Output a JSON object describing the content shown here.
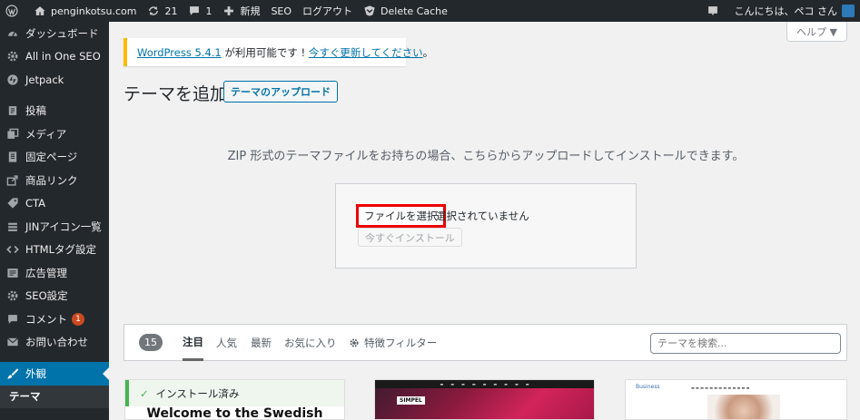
{
  "adminbar": {
    "site_name": "penginkotsu.com",
    "updates_count": "21",
    "comments_count": "1",
    "new_label": "新規",
    "seo_label": "SEO",
    "logout_label": "ログアウト",
    "delete_cache_label": "Delete Cache",
    "greeting": "こんにちは、ペコ さん"
  },
  "sidebar": {
    "items": [
      {
        "label": "ダッシュボード",
        "icon": "dashboard-icon"
      },
      {
        "label": "All in One SEO",
        "icon": "gear-icon"
      },
      {
        "label": "Jetpack",
        "icon": "jetpack-icon"
      },
      {
        "label": "投稿",
        "icon": "pin-icon"
      },
      {
        "label": "メディア",
        "icon": "media-icon"
      },
      {
        "label": "固定ページ",
        "icon": "page-icon"
      },
      {
        "label": "商品リンク",
        "icon": "link-icon"
      },
      {
        "label": "CTA",
        "icon": "tag-icon"
      },
      {
        "label": "JINアイコン一覧",
        "icon": "list-icon"
      },
      {
        "label": "HTMLタグ設定",
        "icon": "code-icon"
      },
      {
        "label": "広告管理",
        "icon": "ad-icon"
      },
      {
        "label": "SEO設定",
        "icon": "gear-icon"
      },
      {
        "label": "コメント",
        "icon": "comment-icon",
        "badge": "1"
      },
      {
        "label": "お問い合わせ",
        "icon": "mail-icon"
      },
      {
        "label": "外観",
        "icon": "brush-icon"
      },
      {
        "label": "テーマ",
        "icon": ""
      }
    ]
  },
  "help_label": "ヘルプ ▼",
  "notice": {
    "version_link": "WordPress 5.4.1",
    "text": " が利用可能です ! ",
    "update_link": "今すぐ更新してください",
    "tail": "。"
  },
  "page": {
    "title": "テーマを追加",
    "upload_button": "テーマのアップロード",
    "upload_description": "ZIP 形式のテーマファイルをお持ちの場合、こちらからアップロードしてインストールできます。",
    "file_button": "ファイルを選択",
    "file_status": "選択されていません",
    "install_button": "今すぐインストール"
  },
  "filter": {
    "count": "15",
    "tabs": [
      "注目",
      "人気",
      "最新",
      "お気に入り"
    ],
    "feature_filter": "特徴フィルター",
    "search_placeholder": "テーマを検索..."
  },
  "themes": {
    "installed_label": "インストール済み",
    "card1_heading": "Welcome to the Swedish",
    "card2_badge": "SIMPEL",
    "card3_brand": "Business"
  },
  "colors": {
    "admin_dark": "#23282d",
    "accent": "#0073aa",
    "notice_border": "#ffb900",
    "highlight_border": "#ee0000",
    "installed_green": "#46b450"
  }
}
